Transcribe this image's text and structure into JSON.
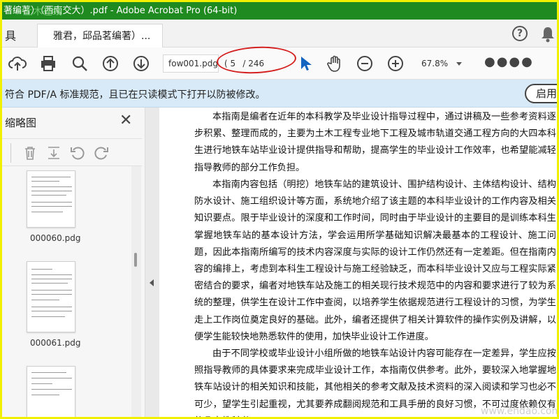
{
  "window": {
    "title": "著编著）（西南交大）.pdf - Adobe Acrobat Pro (64-bit)",
    "watermark": "土木在线"
  },
  "menubar": {
    "tools_label": "具",
    "tab_label": "雅君，邱品茗编著）...",
    "help_label": "?"
  },
  "toolbar": {
    "filename": "fow001.pdg",
    "page_current": "5",
    "page_total": "/ 246",
    "page_open": "(",
    "zoom": "67.8%",
    "more": "●●●●"
  },
  "banner": {
    "text": "符合 PDF/A 标准规范，且已在只读模式下打开以防被修改。",
    "button": "启用"
  },
  "sidebar": {
    "title": "缩略图",
    "close": "✕",
    "thumbnails": [
      {
        "label": "000060.pdg"
      },
      {
        "label": "000061.pdg"
      },
      {
        "label": ""
      }
    ]
  },
  "document": {
    "paragraphs": [
      "本指南是编者在近年的本科教学及毕业设计指导过程中，通过讲稿及一些参考资料逐步积累、整理而成的，主要为土木工程专业地下工程及城市轨道交通工程方向的大四本科生进行地铁车站毕业设计提供指导和帮助，提高学生的毕业设计工作效率，也希望能减轻指导教师的部分工作负担。",
      "本指南内容包括（明挖）地铁车站的建筑设计、围护结构设计、主体结构设计、结构防水设计、施工组织设计等方面，系统地介绍了该主题的本科毕业设计的工作内容及相关知识要点。限于毕业设计的深度和工作时间，同时由于毕业设计的主要目的是训练本科生掌握地铁车站的基本设计方法，学会运用所学基础知识解决最基本的工程设计、施工问题，因此本指南所编写的技术内容深度与实际的设计工作仍然还有一定差距。但在指南内容的编排上，考虑到本科生工程设计与施工经验缺乏，而本科毕业设计又应与工程实际紧密结合的要求，编者对地铁车站及施工的相关现行技术规范中的内容和要求进行了较为系统的整理，供学生在设计工作中查阅，以培养学生依据规范进行工程设计的习惯，为学生走上工作岗位奠定良好的基础。此外，编者还提供了相关计算软件的操作实例及讲解，以便学生能较快地熟悉软件的使用，加快毕业设计工作进度。",
      "由于不同学校或毕业设计小组所做的地铁车站设计内容可能存在一定差异，学生应按照指导教师的具体要求来完成毕业设计工作，本指南仅供参考。此外，要较深入地掌握地铁车站设计的相关知识和技能，其他相关的参考文献及技术资料的深入阅读和学习也必不可少，望学生引起重视，尤其要养成翻阅规范和工具手册的良好习惯，不可过度依赖仅有的几本教科书。"
    ],
    "corner_watermark": "www.ehdao.com"
  }
}
